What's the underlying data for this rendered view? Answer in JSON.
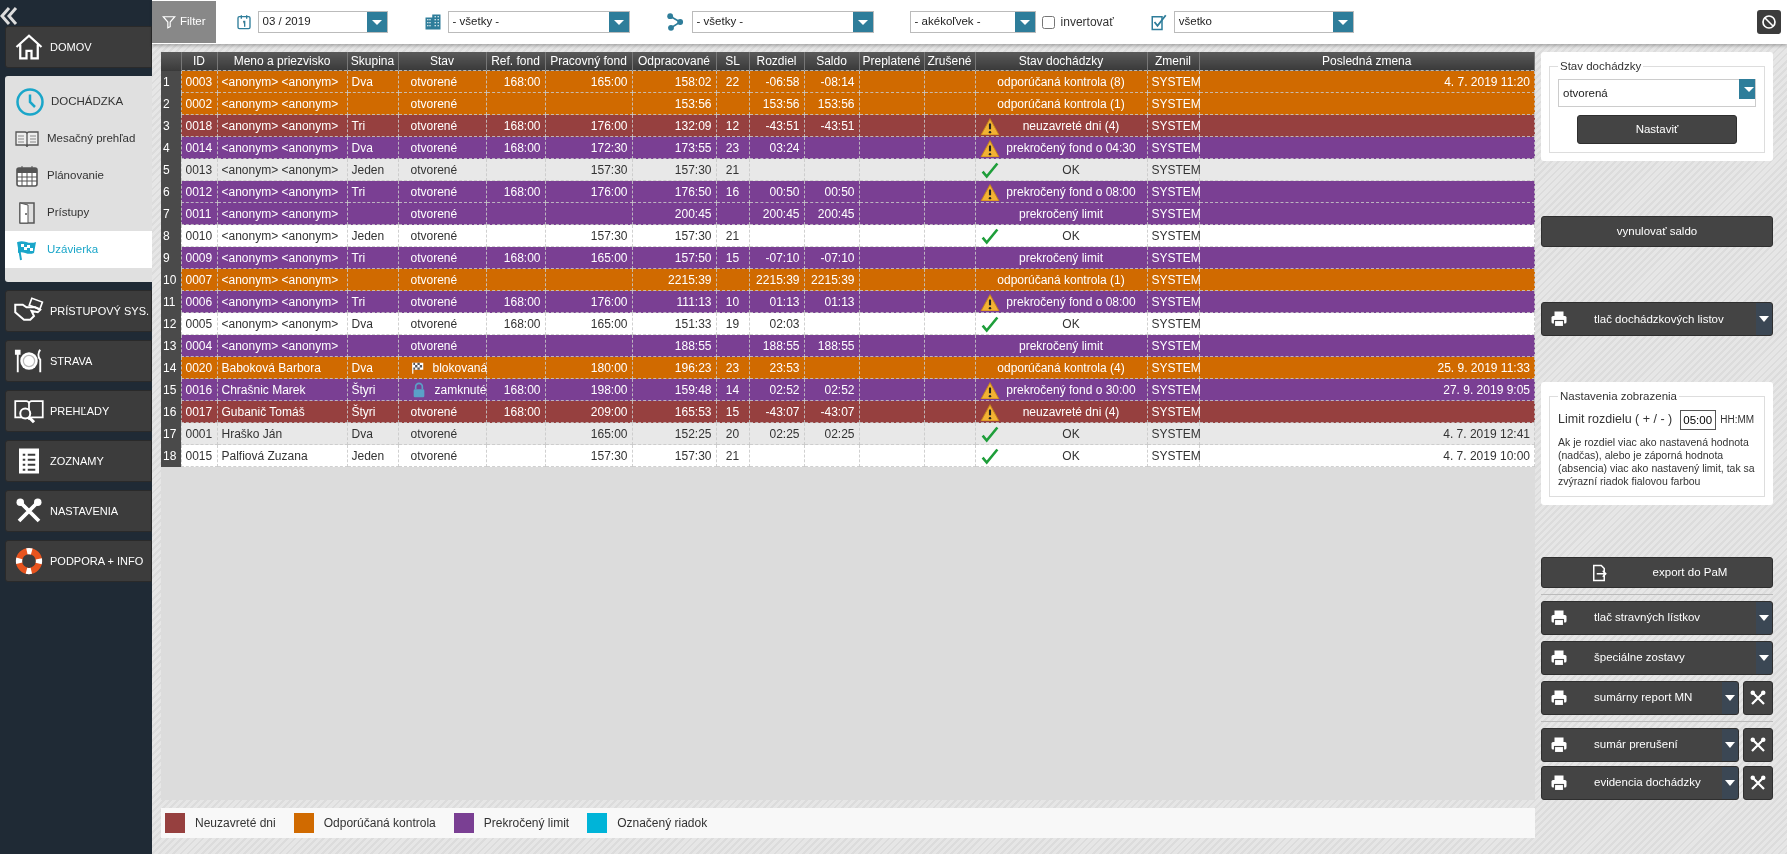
{
  "sidebar": {
    "items": [
      {
        "label": "DOMOV"
      },
      {
        "label": "DOCHÁDZKA",
        "expanded": true,
        "children": [
          {
            "label": "Mesačný prehľad",
            "selected": false
          },
          {
            "label": "Plánovanie",
            "selected": false
          },
          {
            "label": "Prístupy",
            "selected": false
          },
          {
            "label": "Uzávierka",
            "selected": true
          }
        ]
      },
      {
        "label": "PRÍSTUPOVÝ SYS."
      },
      {
        "label": "STRAVA"
      },
      {
        "label": "PREHĽADY"
      },
      {
        "label": "ZOZNAMY"
      },
      {
        "label": "NASTAVENIA"
      },
      {
        "label": "PODPORA + INFO"
      }
    ]
  },
  "toolbar": {
    "filter_button": "Filter",
    "period": "03 / 2019",
    "department": "- všetky -",
    "structure": "- všetky -",
    "type": "- akékoľvek -",
    "invert": {
      "label": "invertovať",
      "checked": false
    },
    "state": "všetko"
  },
  "table": {
    "columns": [
      "ID",
      "Meno a priezvisko",
      "Skupina",
      "Stav",
      "Ref. fond",
      "Pracovný fond",
      "Odpracované",
      "SL",
      "Rozdiel",
      "Saldo",
      "Preplatené",
      "Zrušené",
      "Stav dochádzky",
      "Zmenil",
      "Posledná zmena"
    ],
    "rows": [
      {
        "num": "1",
        "id": "0003",
        "name": "<anonym> <anonym>",
        "group": "Dva",
        "status": {
          "text": "otvorené"
        },
        "ref_fund": "168:00",
        "work_fund": "165:00",
        "worked": "158:02",
        "sl": "22",
        "diff": "-06:58",
        "saldo": "-08:14",
        "attendance": {
          "text": "odporúčaná kontrola (8)"
        },
        "changed_by": "SYSTEM",
        "last_change": "4. 7. 2019 11:20",
        "color": "#d06a00"
      },
      {
        "num": "2",
        "id": "0002",
        "name": "<anonym> <anonym>",
        "status": {
          "text": "otvorené"
        },
        "worked": "153:56",
        "diff": "153:56",
        "saldo": "153:56",
        "attendance": {
          "text": "odporúčaná kontrola (1)"
        },
        "changed_by": "SYSTEM",
        "color": "#d06a00"
      },
      {
        "num": "3",
        "id": "0018",
        "name": "<anonym> <anonym>",
        "group": "Tri",
        "status": {
          "text": "otvorené"
        },
        "ref_fund": "168:00",
        "work_fund": "176:00",
        "worked": "132:09",
        "sl": "12",
        "diff": "-43:51",
        "saldo": "-43:51",
        "attendance": {
          "text": "neuzavreté dni (4)",
          "kind": "warning"
        },
        "changed_by": "SYSTEM",
        "color": "#96403f"
      },
      {
        "num": "4",
        "id": "0014",
        "name": "<anonym> <anonym>",
        "group": "Dva",
        "status": {
          "text": "otvorené"
        },
        "ref_fund": "168:00",
        "work_fund": "172:30",
        "worked": "173:55",
        "sl": "23",
        "diff": "03:24",
        "attendance": {
          "text": "prekročený fond o 04:30",
          "kind": "warning"
        },
        "changed_by": "SYSTEM",
        "color": "#7a3f93"
      },
      {
        "num": "5",
        "id": "0013",
        "name": "<anonym> <anonym>",
        "group": "Jeden",
        "status": {
          "text": "otvorené"
        },
        "work_fund": "157:30",
        "worked": "157:30",
        "sl": "21",
        "attendance": {
          "text": "OK",
          "kind": "ok"
        },
        "changed_by": "SYSTEM"
      },
      {
        "num": "6",
        "id": "0012",
        "name": "<anonym> <anonym>",
        "group": "Tri",
        "status": {
          "text": "otvorené"
        },
        "ref_fund": "168:00",
        "work_fund": "176:00",
        "worked": "176:50",
        "sl": "16",
        "diff": "00:50",
        "saldo": "00:50",
        "attendance": {
          "text": "prekročený fond o 08:00",
          "kind": "warning"
        },
        "changed_by": "SYSTEM",
        "color": "#7a3f93"
      },
      {
        "num": "7",
        "id": "0011",
        "name": "<anonym> <anonym>",
        "status": {
          "text": "otvorené"
        },
        "worked": "200:45",
        "diff": "200:45",
        "saldo": "200:45",
        "attendance": {
          "text": "prekročený limit"
        },
        "changed_by": "SYSTEM",
        "color": "#7a3f93"
      },
      {
        "num": "8",
        "id": "0010",
        "name": "<anonym> <anonym>",
        "group": "Jeden",
        "status": {
          "text": "otvorené"
        },
        "work_fund": "157:30",
        "worked": "157:30",
        "sl": "21",
        "attendance": {
          "text": "OK",
          "kind": "ok"
        },
        "changed_by": "SYSTEM"
      },
      {
        "num": "9",
        "id": "0009",
        "name": "<anonym> <anonym>",
        "group": "Tri",
        "status": {
          "text": "otvorené"
        },
        "ref_fund": "168:00",
        "work_fund": "165:00",
        "worked": "157:50",
        "sl": "15",
        "diff": "-07:10",
        "saldo": "-07:10",
        "attendance": {
          "text": "prekročený limit"
        },
        "changed_by": "SYSTEM",
        "color": "#7a3f93"
      },
      {
        "num": "10",
        "id": "0007",
        "name": "<anonym> <anonym>",
        "status": {
          "text": "otvorené"
        },
        "worked": "2215:39",
        "diff": "2215:39",
        "saldo": "2215:39",
        "attendance": {
          "text": "odporúčaná kontrola (1)"
        },
        "changed_by": "SYSTEM",
        "color": "#d06a00"
      },
      {
        "num": "11",
        "id": "0006",
        "name": "<anonym> <anonym>",
        "group": "Tri",
        "status": {
          "text": "otvorené"
        },
        "ref_fund": "168:00",
        "work_fund": "176:00",
        "worked": "111:13",
        "sl": "10",
        "diff": "01:13",
        "saldo": "01:13",
        "attendance": {
          "text": "prekročený fond o 08:00",
          "kind": "warning"
        },
        "changed_by": "SYSTEM",
        "color": "#7a3f93"
      },
      {
        "num": "12",
        "id": "0005",
        "name": "<anonym> <anonym>",
        "group": "Dva",
        "status": {
          "text": "otvorené"
        },
        "ref_fund": "168:00",
        "work_fund": "165:00",
        "worked": "151:33",
        "sl": "19",
        "diff": "02:03",
        "attendance": {
          "text": "OK",
          "kind": "ok"
        },
        "changed_by": "SYSTEM"
      },
      {
        "num": "13",
        "id": "0004",
        "name": "<anonym> <anonym>",
        "status": {
          "text": "otvorené"
        },
        "worked": "188:55",
        "diff": "188:55",
        "saldo": "188:55",
        "attendance": {
          "text": "prekročený limit"
        },
        "changed_by": "SYSTEM",
        "color": "#7a3f93"
      },
      {
        "num": "14",
        "id": "0020",
        "name": "Baboková Barbora",
        "group": "Dva",
        "status": {
          "text": "blokovaná",
          "kind": "blocked"
        },
        "work_fund": "180:00",
        "worked": "196:23",
        "sl": "23",
        "diff": "23:53",
        "attendance": {
          "text": "odporúčaná kontrola (4)"
        },
        "changed_by": "SYSTEM",
        "last_change": "25. 9. 2019 11:33",
        "color": "#d06a00"
      },
      {
        "num": "15",
        "id": "0016",
        "name": "Chrašnic Marek",
        "group": "Štyri",
        "status": {
          "text": "zamknuté",
          "kind": "locked"
        },
        "ref_fund": "168:00",
        "work_fund": "198:00",
        "worked": "159:48",
        "sl": "14",
        "diff": "02:52",
        "saldo": "02:52",
        "attendance": {
          "text": "prekročený fond o 30:00",
          "kind": "warning"
        },
        "changed_by": "SYSTEM",
        "last_change": "27. 9. 2019 9:05",
        "color": "#7a3f93"
      },
      {
        "num": "16",
        "id": "0017",
        "name": "Gubanič Tomáš",
        "group": "Štyri",
        "status": {
          "text": "otvorené"
        },
        "ref_fund": "168:00",
        "work_fund": "209:00",
        "worked": "165:53",
        "sl": "15",
        "diff": "-43:07",
        "saldo": "-43:07",
        "attendance": {
          "text": "neuzavreté dni (4)",
          "kind": "warning"
        },
        "changed_by": "SYSTEM",
        "color": "#96403f"
      },
      {
        "num": "17",
        "id": "0001",
        "name": "Hraško Ján",
        "group": "Dva",
        "status": {
          "text": "otvorené"
        },
        "work_fund": "165:00",
        "worked": "152:25",
        "sl": "20",
        "diff": "02:25",
        "saldo": "02:25",
        "attendance": {
          "text": "OK",
          "kind": "ok"
        },
        "changed_by": "SYSTEM",
        "last_change": "4. 7. 2019 12:41"
      },
      {
        "num": "18",
        "id": "0015",
        "name": "Palfiová Zuzana",
        "group": "Jeden",
        "status": {
          "text": "otvorené"
        },
        "work_fund": "157:30",
        "worked": "157:30",
        "sl": "21",
        "attendance": {
          "text": "OK",
          "kind": "ok"
        },
        "changed_by": "SYSTEM",
        "last_change": "4. 7. 2019 10:00"
      }
    ]
  },
  "legend": [
    {
      "label": "Neuzavreté dni",
      "color": "#96403f"
    },
    {
      "label": "Odporúčaná kontrola",
      "color": "#d06a00"
    },
    {
      "label": "Prekročený limit",
      "color": "#7a3f93"
    },
    {
      "label": "Označený riadok",
      "color": "#00b4d8"
    }
  ],
  "side_panel": {
    "state_box": {
      "title": "Stav dochádzky",
      "value": "otvorená",
      "button": "Nastaviť"
    },
    "reset_button": "vynulovať saldo",
    "print_sheets_button": "tlač dochádzkových listov",
    "display_settings": {
      "title": "Nastavenia zobrazenia",
      "limit_label": "Limit rozdielu ( + / - )",
      "limit_value": "05:00",
      "unit": "HH:MM",
      "note": "Ak je rozdiel viac ako nastavená hodnota (nadčas), alebo je záporná hodnota (absencia) viac ako nastavený limit, tak sa zvýrazní riadok fialovou farbou"
    },
    "action_groups": [
      [
        {
          "label": "export do PaM",
          "kind": "export"
        }
      ],
      [
        {
          "label": "tlač stravných lístkov",
          "kind": "menu"
        },
        {
          "label": "špeciálne zostavy",
          "kind": "menu"
        },
        {
          "label": "sumárny report MN",
          "kind": "menu_tools"
        }
      ],
      [
        {
          "label": "sumár prerušení",
          "kind": "menu_tools"
        },
        {
          "label": "evidencia dochádzky",
          "kind": "menu_tools"
        }
      ]
    ]
  }
}
